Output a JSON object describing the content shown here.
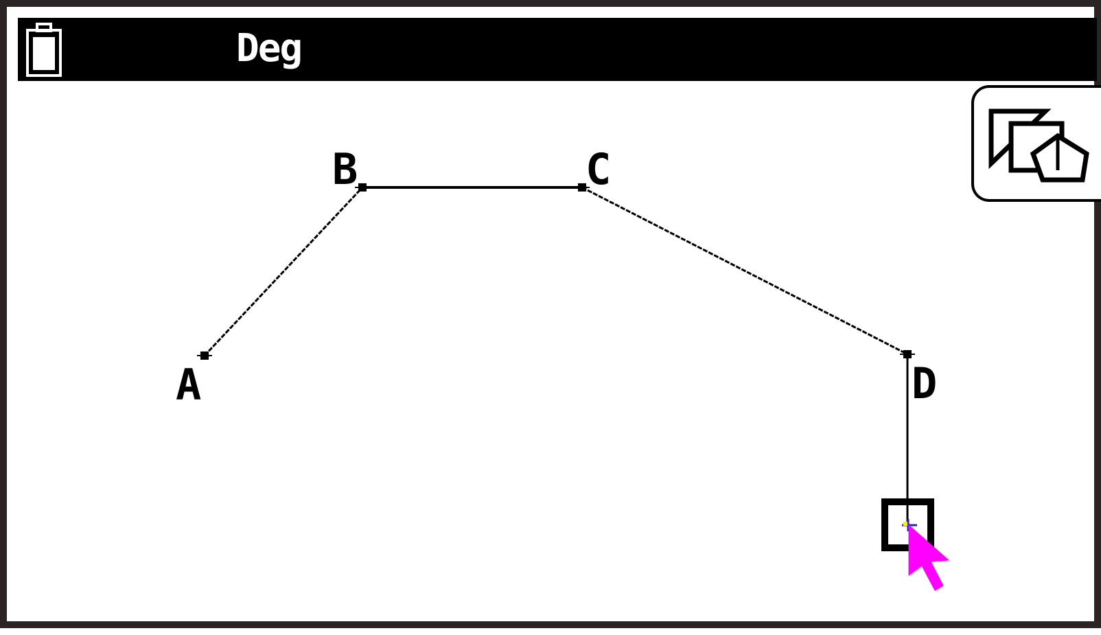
{
  "status_bar": {
    "battery_icon": "battery-icon",
    "angle_mode": "Deg"
  },
  "geometry": {
    "points": [
      {
        "id": "A",
        "label": "A"
      },
      {
        "id": "B",
        "label": "B"
      },
      {
        "id": "C",
        "label": "C"
      },
      {
        "id": "D",
        "label": "D"
      }
    ]
  },
  "toolbar": {
    "view_toggle_icon": "geometry-view-toggle-icon"
  },
  "cursor": {
    "color": "#ff00ff",
    "crosshair_color": "#2222cc",
    "crosshair_accent": "#ffee00"
  }
}
